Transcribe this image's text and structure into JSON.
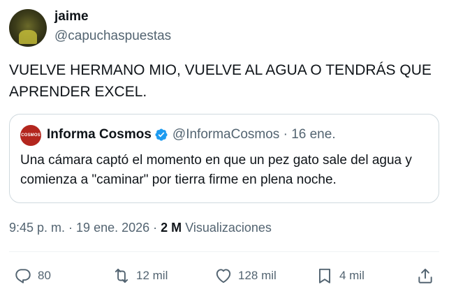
{
  "author": {
    "name": "jaime",
    "handle": "@capuchaspuestas"
  },
  "tweet": {
    "text": "VUELVE HERMANO MIO, VUELVE AL AGUA O TENDRÁS QUE APRENDER EXCEL."
  },
  "quoted_tweet": {
    "avatar_text": "COSMOS",
    "name": "Informa Cosmos",
    "handle": "@InformaCosmos",
    "separator": " · ",
    "date": "16 ene.",
    "text": "Una cámara captó el momento en que un pez gato sale del agua y comienza a \"caminar\" por tierra firme en plena noche."
  },
  "meta": {
    "time": "9:45 p. m.",
    "separator": " · ",
    "date": "19 ene. 2026",
    "views_count": "2 M",
    "views_label": "Visualizaciones"
  },
  "actions": {
    "replies": "80",
    "retweets": "12 mil",
    "likes": "128 mil",
    "bookmarks": "4 mil"
  },
  "colors": {
    "text": "#0f1419",
    "secondary": "#536471",
    "border": "#cfd9de",
    "verified": "#1d9bf0",
    "cosmos_brand": "#b3261e"
  },
  "icons": [
    "reply-icon",
    "retweet-icon",
    "like-icon",
    "bookmark-icon",
    "share-icon",
    "verified-badge-icon"
  ]
}
